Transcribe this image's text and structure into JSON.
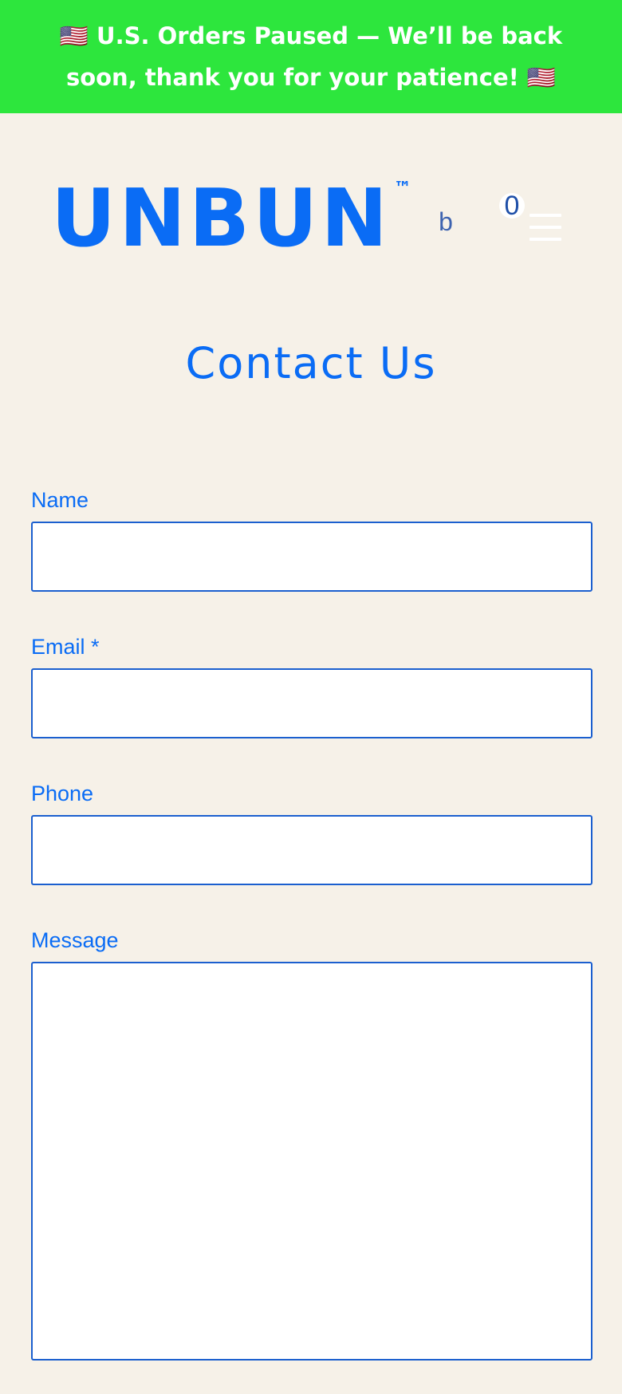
{
  "announcement": {
    "text": "🇺🇸 U.S. Orders Paused — We’ll be back soon, thank you for your patience! 🇺🇸"
  },
  "header": {
    "logo_text": "UNBUN",
    "logo_tm": "™",
    "search_glyph": "b",
    "cart_count": "0",
    "icons": [
      "search-icon",
      "cart-icon",
      "hamburger-menu-icon"
    ]
  },
  "page": {
    "title": "Contact Us"
  },
  "form": {
    "name_label": "Name",
    "name_value": "",
    "email_label": "Email *",
    "email_value": "",
    "phone_label": "Phone",
    "phone_value": "",
    "message_label": "Message",
    "message_value": ""
  },
  "colors": {
    "announcement_bg": "#2de63d",
    "page_bg": "#f6f1e8",
    "brand_blue": "#0a6cf5",
    "input_border": "#1b5fcf"
  }
}
